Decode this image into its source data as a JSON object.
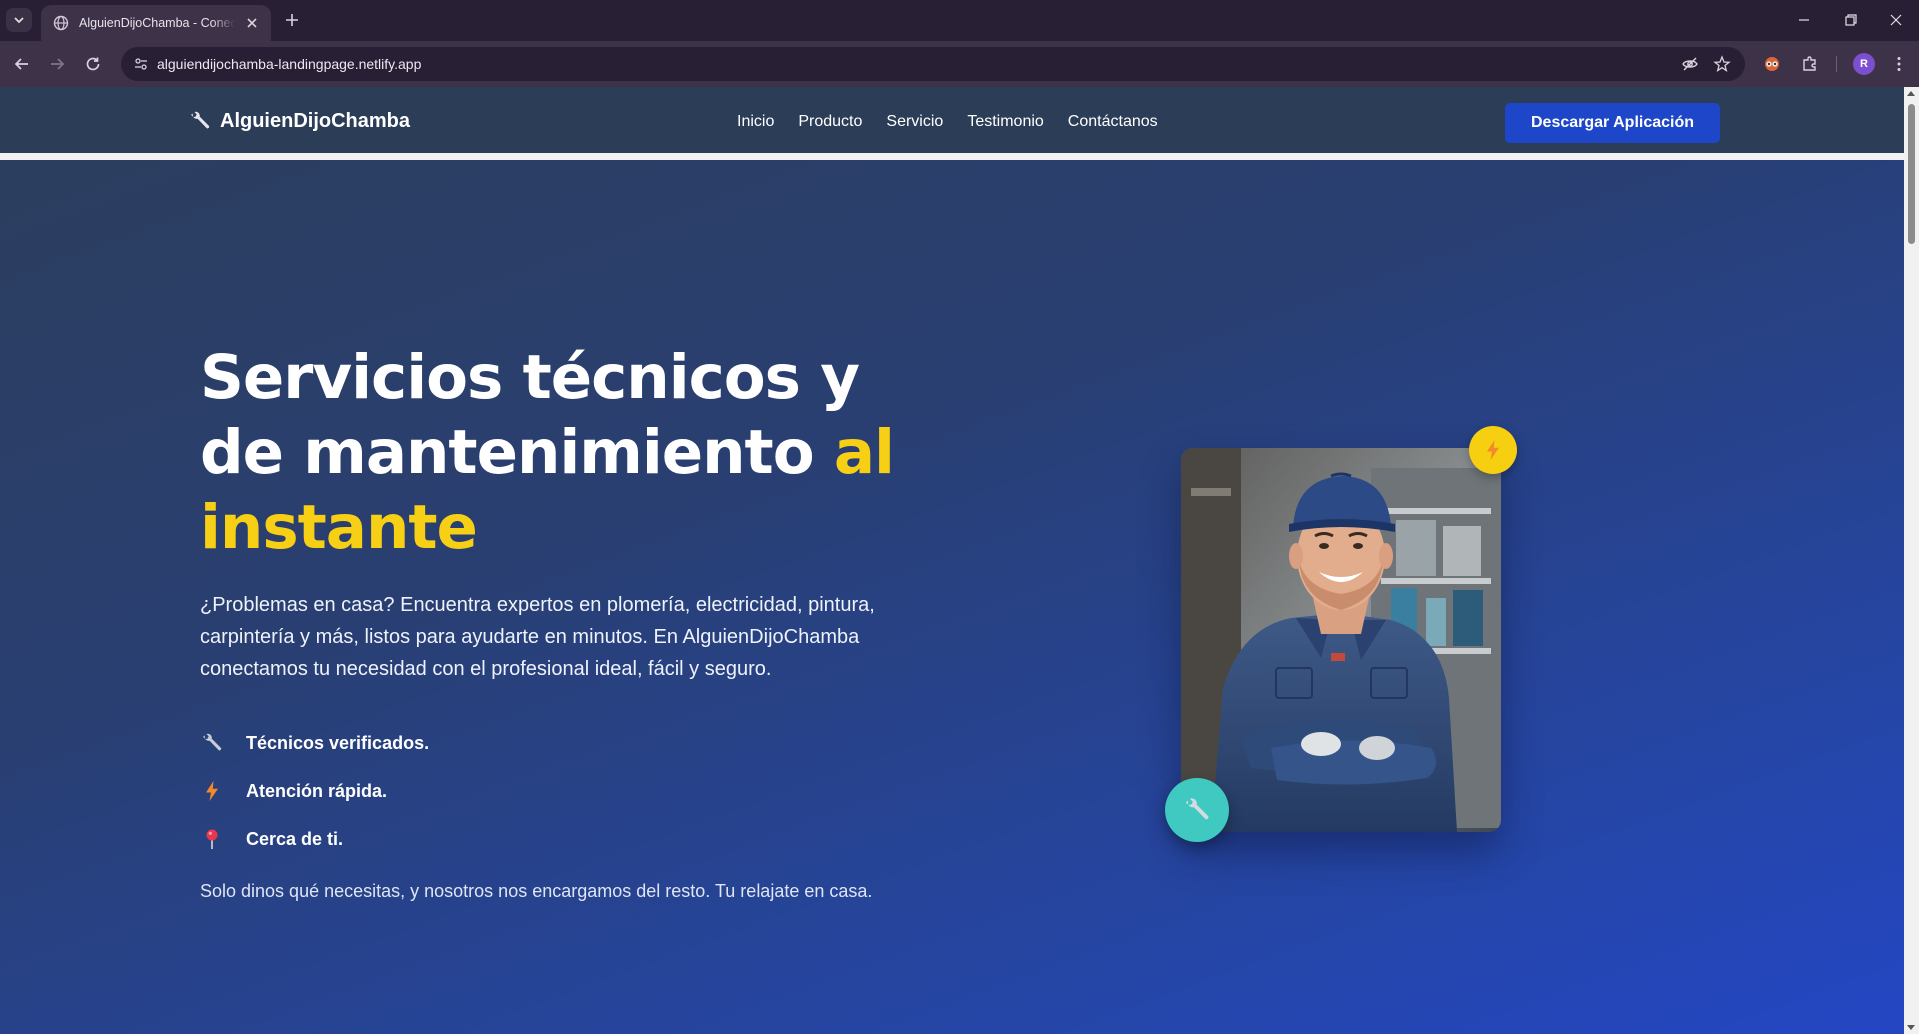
{
  "browser": {
    "tab_title": "AlguienDijoChamba - Conectamos",
    "url": "alguiendijochamba-landingpage.netlify.app",
    "profile_initial": "R"
  },
  "header": {
    "brand": "AlguienDijoChamba",
    "nav": [
      {
        "label": "Inicio"
      },
      {
        "label": "Producto"
      },
      {
        "label": "Servicio"
      },
      {
        "label": "Testimonio"
      },
      {
        "label": "Contáctanos"
      }
    ],
    "cta": "Descargar Aplicación"
  },
  "hero": {
    "title_main": "Servicios técnicos y de mantenimiento",
    "title_accent": "al instante",
    "description": "¿Problemas en casa? Encuentra expertos en plomería, electricidad, pintura, carpintería y más, listos para ayudarte en minutos. En AlguienDijoChamba conectamos tu necesidad con el profesional ideal, fácil y seguro.",
    "features": [
      {
        "icon": "wrench-icon",
        "text": "Técnicos verificados."
      },
      {
        "icon": "lightning-icon",
        "text": "Atención rápida."
      },
      {
        "icon": "pin-icon",
        "text": "Cerca de ti."
      }
    ],
    "footnote": "Solo dinos qué necesitas, y nosotros nos encargamos del resto. Tu relajate en casa."
  },
  "colors": {
    "accent_yellow": "#f7cf14",
    "cta_blue": "#1e46c8",
    "teal_badge": "#3fc9c0"
  }
}
